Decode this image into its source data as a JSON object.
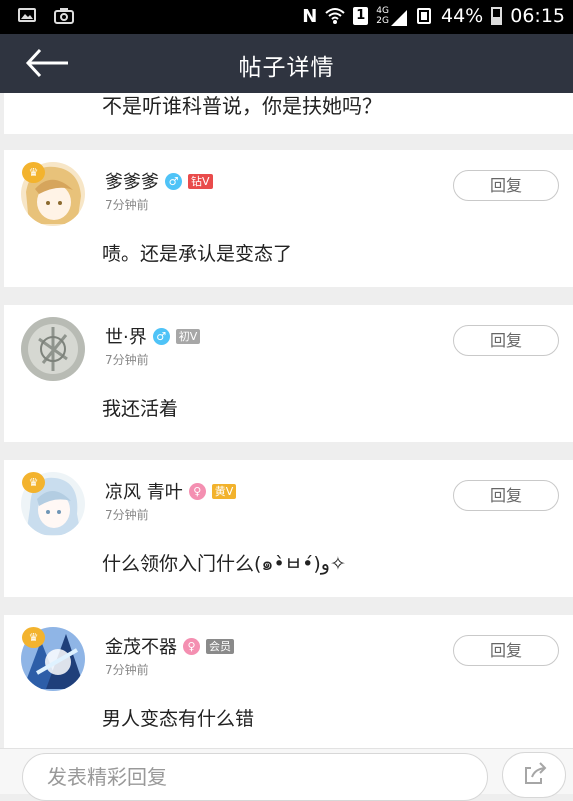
{
  "status_bar": {
    "left_icons": [
      "image-icon",
      "camera-icon"
    ],
    "right_icons": [
      "nfc-icon",
      "wifi-icon",
      "sim-icon",
      "signal-icon",
      "vibrate-icon",
      "battery-icon"
    ],
    "nfc_label": "N",
    "sim_label": "1",
    "network_top": "4G",
    "network_bottom": "2G",
    "battery_percent": "44%",
    "time": "06:15"
  },
  "header": {
    "title": "帖子详情",
    "back_icon": "back-arrow-icon"
  },
  "previous_comment": {
    "text": "不是听谁科普说，你是扶她吗？"
  },
  "comments": [
    {
      "name": "爹爹爹",
      "gender": "male",
      "gender_symbol": "♂",
      "badge": "钻V",
      "badge_color": "#e94b4b",
      "time": "7分钟前",
      "reply_label": "回复",
      "text": "啧。还是承认是变态了",
      "crown": true
    },
    {
      "name": "世·界",
      "gender": "male",
      "gender_symbol": "♂",
      "badge": "初V",
      "badge_color": "#a7a7a7",
      "time": "7分钟前",
      "reply_label": "回复",
      "text": "我还活着",
      "crown": false
    },
    {
      "name": "凉风 青叶",
      "gender": "female",
      "gender_symbol": "♀",
      "badge": "黄V",
      "badge_color": "#f2b22c",
      "time": "7分钟前",
      "reply_label": "回复",
      "text": "什么领你入门什么(๑•̀ㅂ•́)و✧",
      "crown": true
    },
    {
      "name": "金茂不器",
      "gender": "female",
      "gender_symbol": "♀",
      "badge": "会员",
      "badge_color": "#8a8a8a",
      "time": "7分钟前",
      "reply_label": "回复",
      "text": "男人变态有什么错",
      "crown": true
    }
  ],
  "input_bar": {
    "placeholder": "发表精彩回复",
    "share_icon": "share-icon"
  },
  "colors": {
    "header": "#2f3440",
    "status_bar": "#000000",
    "background": "#eeeeee",
    "male": "#4fc3f7",
    "female": "#f48fb1",
    "crown": "#f3b32e"
  }
}
